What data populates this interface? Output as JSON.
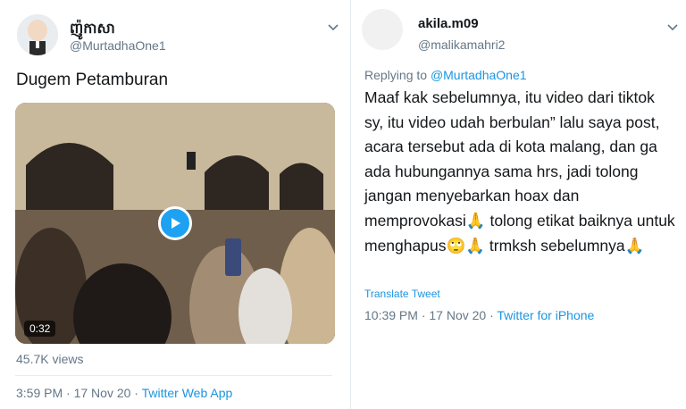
{
  "left_tweet": {
    "display_name": "ញ៉ូកាសា",
    "handle": "@MurtadhaOne1",
    "text": "Dugem Petamburan",
    "video": {
      "duration": "0:32"
    },
    "views": "45.7K views",
    "time": "3:59 PM · 17 Nov 20 · ",
    "source": "Twitter Web App"
  },
  "right_tweet": {
    "display_name": "akila.m09",
    "handle": "@malikamahri2",
    "replying_to_prefix": "Replying to ",
    "replying_to": "@MurtadhaOne1",
    "text_1": "Maaf kak sebelumnya, itu video dari tiktok sy, itu video udah berbulan” lalu saya post, acara tersebut ada di kota malang, dan ga ada hubungannya sama hrs, jadi tolong jangan menyebarkan hoax dan memprovokasi",
    "emoji_1": "🙏",
    "text_2": " tolong etikat baiknya untuk menghapus",
    "emoji_2": "🙄",
    "emoji_3": "🙏",
    "text_3": " trmksh sebelumnya",
    "emoji_4": "🙏",
    "translate": "Translate Tweet",
    "time": "10:39 PM · 17 Nov 20 · ",
    "source": "Twitter for iPhone"
  },
  "colors": {
    "link": "#1b95e0",
    "play_button": "#1da1f2",
    "secondary_text": "#657786"
  }
}
